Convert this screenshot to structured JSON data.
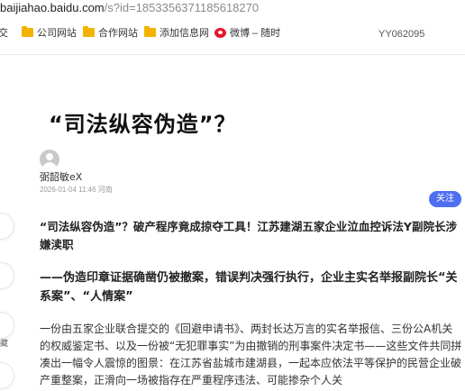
{
  "browser": {
    "url_host": "baijiahao.baidu.com",
    "url_path": "/s?id=1853356371185618270"
  },
  "bookmarks": [
    {
      "label": "交",
      "icon": "folder-icon"
    },
    {
      "label": "公司网站",
      "icon": "folder-icon"
    },
    {
      "label": "合作网站",
      "icon": "folder-icon"
    },
    {
      "label": "添加信息网",
      "icon": "folder-icon"
    },
    {
      "label": "微博 – 随时",
      "icon": "weibo-icon"
    }
  ],
  "overlay_stamp": "YY062095",
  "article": {
    "title": "“司法纵容伪造”？",
    "author": "弼韶敏eX",
    "meta": "2026-01-04 11:46  河南",
    "follow_label": "关注",
    "lead": "“司法纵容伪造”？破产程序竟成掠夺工具！江苏建湖五家企业泣血控诉法Y副院长涉嫌渎职",
    "subheading": "——伪造印章证据确凿仍被撤案，错误判决强行执行，企业主实名举报副院长“关系案”、“人情案”",
    "body": "一份由五家企业联合提交的《回避申请书》、两封长达万言的实名举报信、三份公A机关的权威鉴定书、以及一份被“无犯罪事实”为由撤销的刑事案件决定书——这些文件共同拼凑出一幅令人震惊的图景：在江苏省盐城市建湖县，一起本应依法平等保护的民营企业破产重整案，正滑向一场被指存在严重程序违法、可能掺杂个人关"
  },
  "side_actions": [
    {
      "label": ""
    },
    {
      "label": ""
    },
    {
      "label": "藏"
    },
    {
      "label": ""
    }
  ]
}
